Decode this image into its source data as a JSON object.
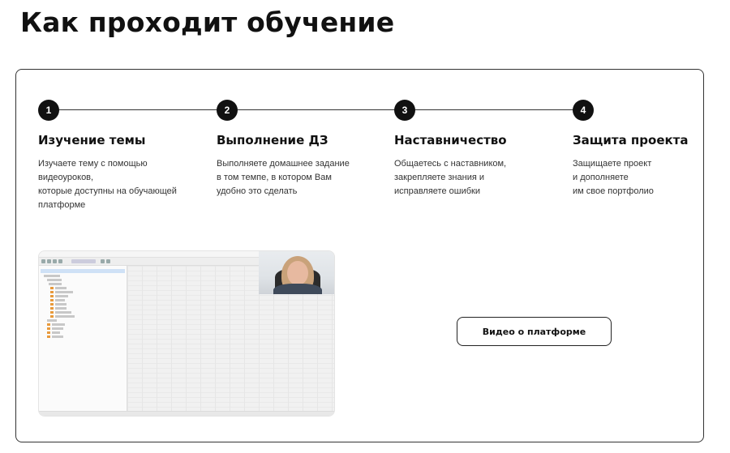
{
  "page": {
    "title": "Как проходит обучение"
  },
  "steps": [
    {
      "number": "1",
      "title": "Изучение темы",
      "description": [
        "Изучаете тему с помощью",
        "видеоуроков,",
        "которые доступны на обучающей",
        "платформе"
      ]
    },
    {
      "number": "2",
      "title": "Выполнение ДЗ",
      "description": [
        "Выполняете домашнее задание",
        "в том темпе, в котором Вам",
        "удобно это сделать"
      ]
    },
    {
      "number": "3",
      "title": "Наставничество",
      "description": [
        "Общаетесь с наставником,",
        "закрепляете знания и",
        "исправляете ошибки"
      ]
    },
    {
      "number": "4",
      "title": "Защита проекта",
      "description": [
        "Защищаете проект",
        "и дополняете",
        "им свое портфолио"
      ]
    }
  ],
  "video": {
    "button_label": "Видео о платформе"
  },
  "colors": {
    "text": "#111111",
    "border": "#333333",
    "background": "#ffffff"
  }
}
